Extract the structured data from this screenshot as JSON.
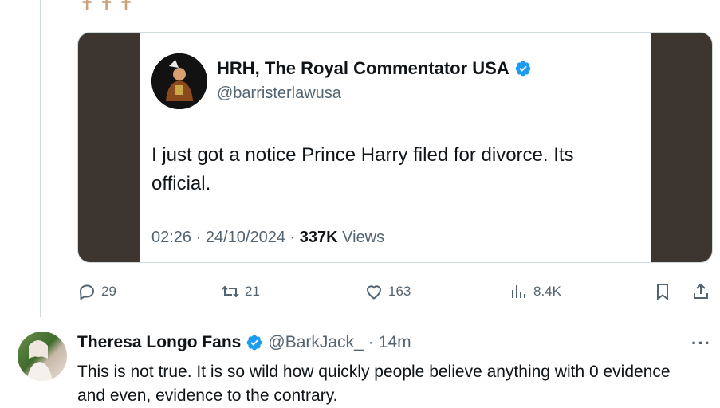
{
  "quoted_post": {
    "author_name": "HRH, The Royal Commentator USA",
    "author_handle": "@barristerlawusa",
    "text": "I just got a notice Prince Harry filed for divorce.  Its official.",
    "time": "02:26",
    "date": "24/10/2024",
    "separator": "·",
    "views_count": "337K",
    "views_label": "Views"
  },
  "actions": {
    "replies": "29",
    "reposts": "21",
    "likes": "163",
    "views": "8.4K"
  },
  "reply": {
    "author_name": "Theresa Longo Fans",
    "author_handle": "@BarkJack_",
    "separator": "·",
    "time_ago": "14m",
    "text": "This is not true. It is so wild how quickly people believe anything with 0 evidence and even, evidence to the contrary.",
    "more": "···"
  },
  "colors": {
    "verified": "#1d9bf0",
    "muted_text": "#536471",
    "media_border": "#3d3530"
  }
}
